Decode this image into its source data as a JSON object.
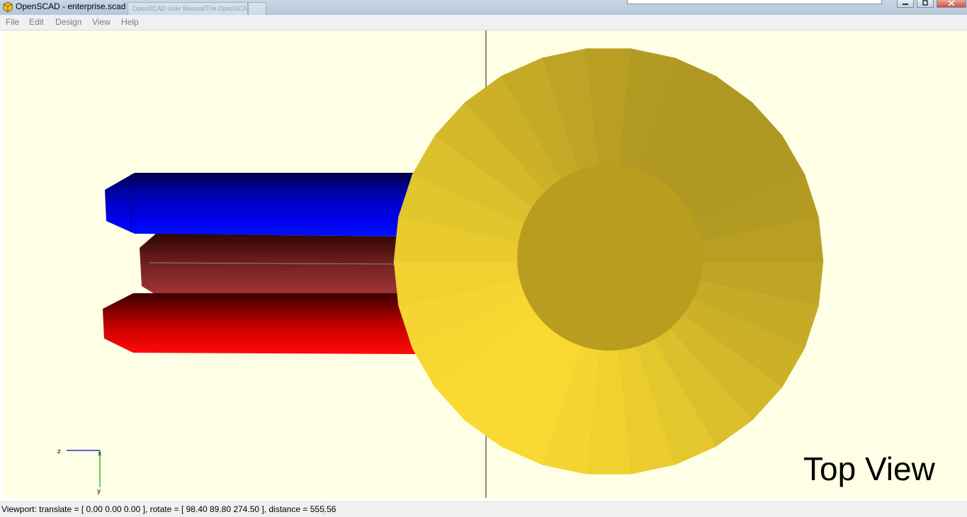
{
  "window": {
    "title": "OpenSCAD - enterprise.scad",
    "background_tab_label": "OpenSCAD User Manual/The OpenSCA..."
  },
  "menu": [
    "File",
    "Edit",
    "Design",
    "View",
    "Help"
  ],
  "viewport": {
    "background_color": "#ffffe6",
    "overlay_label": "Top View",
    "axes": {
      "z_label": "z",
      "x_label": "x",
      "y_label": "y"
    },
    "model": {
      "saucer_color": "#d4b82a",
      "nacelle_colors": [
        "blue",
        "dark-red",
        "red"
      ]
    }
  },
  "statusbar": {
    "text": "Viewport: translate = [ 0.00 0.00 0.00 ], rotate = [ 98.40 89.80 274.50 ], distance = 555.56"
  }
}
